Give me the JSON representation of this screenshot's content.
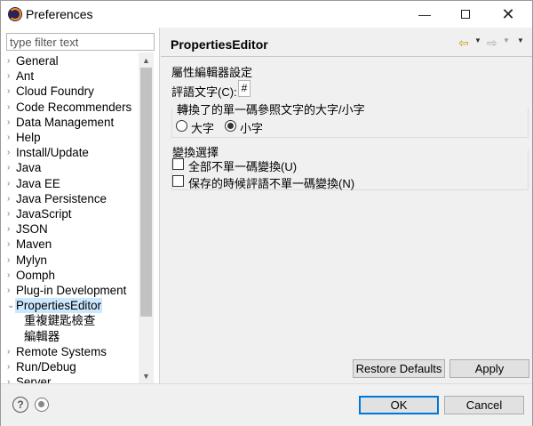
{
  "window": {
    "title": "Preferences",
    "minimize_glyph": "—",
    "close_glyph": "✕"
  },
  "left": {
    "filter_placeholder": "type filter text",
    "tree": [
      {
        "label": "General",
        "arrow": "›",
        "top": 1
      },
      {
        "label": "Ant",
        "arrow": "›"
      },
      {
        "label": "Cloud Foundry",
        "arrow": "›"
      },
      {
        "label": "Code Recommenders",
        "arrow": "›"
      },
      {
        "label": "Data Management",
        "arrow": "›"
      },
      {
        "label": "Help",
        "arrow": "›"
      },
      {
        "label": "Install/Update",
        "arrow": "›"
      },
      {
        "label": "Java",
        "arrow": "›"
      },
      {
        "label": "Java EE",
        "arrow": "›"
      },
      {
        "label": "Java Persistence",
        "arrow": "›"
      },
      {
        "label": "JavaScript",
        "arrow": "›"
      },
      {
        "label": "JSON",
        "arrow": "›"
      },
      {
        "label": "Maven",
        "arrow": "›"
      },
      {
        "label": "Mylyn",
        "arrow": "›"
      },
      {
        "label": "Oomph",
        "arrow": "›"
      },
      {
        "label": "Plug-in Development",
        "arrow": "›"
      },
      {
        "label": "PropertiesEditor",
        "arrow": "⌄",
        "selected": true
      },
      {
        "label": "重複鍵匙檢查",
        "child": true
      },
      {
        "label": "編輯器",
        "child": true
      },
      {
        "label": "Remote Systems",
        "arrow": "›"
      },
      {
        "label": "Run/Debug",
        "arrow": "›"
      },
      {
        "label": "Server",
        "arrow": "›"
      }
    ],
    "scroll_up_glyph": "▲",
    "scroll_down_glyph": "▼"
  },
  "right": {
    "page_title": "PropertiesEditor",
    "nav": {
      "back": "⇦",
      "forward": "⇨",
      "dropdown": "▼"
    },
    "section_label": "屬性編輯器設定",
    "field_label": "評語文字(C):",
    "field_value": "#",
    "case_group": {
      "title": "轉換了的單一碼參照文字的大字/小字",
      "options": [
        "大字",
        "小字"
      ],
      "selected": "小字"
    },
    "convert_group": {
      "title": "變換選擇",
      "options": [
        "全部不單一碼變換(U)",
        "保存的時候評語不單一碼變換(N)"
      ],
      "checked": [
        false,
        false
      ]
    },
    "restore_defaults": "Restore Defaults",
    "apply": "Apply"
  },
  "bottom": {
    "help_glyph": "?",
    "ok": "OK",
    "cancel": "Cancel"
  }
}
